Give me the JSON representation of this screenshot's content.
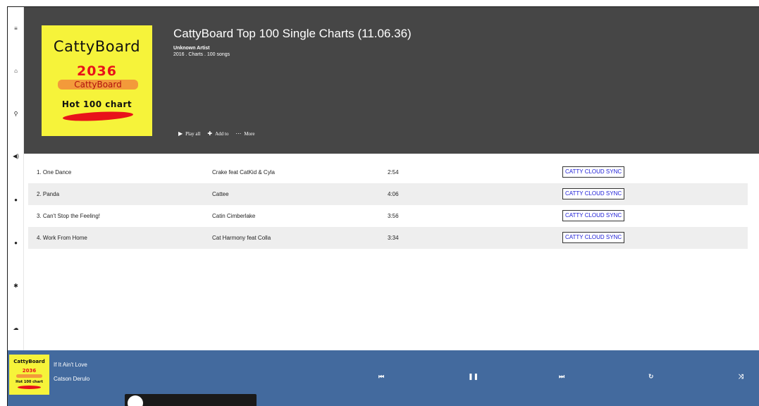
{
  "sidebar": {
    "items": [
      {
        "icon": "menu-icon",
        "glyph": "≡"
      },
      {
        "icon": "home-icon",
        "glyph": "⌂"
      },
      {
        "icon": "search-icon",
        "glyph": "⚲"
      },
      {
        "icon": "volume-icon",
        "glyph": "◀)"
      },
      {
        "icon": "user-icon",
        "glyph": "●"
      },
      {
        "icon": "spotify-icon",
        "glyph": "●"
      },
      {
        "icon": "settings-icon",
        "glyph": "✱"
      },
      {
        "icon": "soundcloud-icon",
        "glyph": "☁"
      }
    ]
  },
  "album": {
    "cover": {
      "brand": "CattyBoard",
      "year": "2036",
      "sub": "CattyBoard",
      "hot": "Hot 100 chart"
    },
    "title": "CattyBoard Top 100 Single Charts (11.06.36)",
    "artist": "Unknown Artist",
    "meta": "2016 . Charts . 100 songs",
    "actions": {
      "play_all": "Play all",
      "add_to": "Add to",
      "more": "More"
    }
  },
  "tracks": [
    {
      "title": "1. One Dance",
      "artist": "Crake feat CatKid & Cyla",
      "duration": "2:54",
      "action": "CATTY CLOUD SYNC"
    },
    {
      "title": "2. Panda",
      "artist": "Cattee",
      "duration": "4:06",
      "action": "CATTY CLOUD SYNC"
    },
    {
      "title": "3. Can't Stop the Feeling!",
      "artist": "Catin Cimberlake",
      "duration": "3:56",
      "action": "CATTY CLOUD SYNC"
    },
    {
      "title": "4. Work From Home",
      "artist": "Cat Harmony feat Colla",
      "duration": "3:34",
      "action": "CATTY CLOUD SYNC"
    }
  ],
  "player": {
    "mini_cover": {
      "brand": "CattyBoard",
      "year": "2036",
      "hot": "Hot 100 chart"
    },
    "now_title": "If It Ain't Love",
    "now_artist": "Catson Derulo",
    "controls": {
      "previous": "⏮",
      "pause": "❚❚",
      "next": "⏭",
      "repeat": "↻",
      "shuffle": "⤨"
    }
  },
  "colors": {
    "header_bg": "#464646",
    "player_bg": "#436a9e",
    "cover_bg": "#f6f33a",
    "sync_text": "#1a1ad6"
  }
}
